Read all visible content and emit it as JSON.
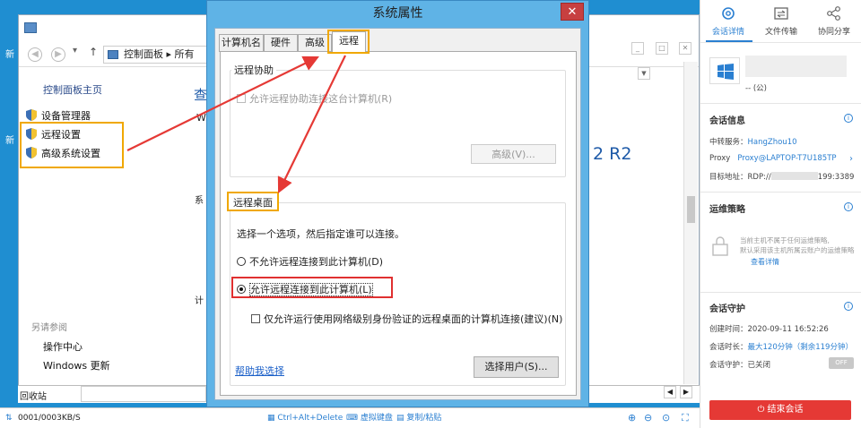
{
  "control_panel": {
    "window_icon_text": "",
    "side_label_1": "新",
    "side_label_2": "新",
    "breadcrumb": "控制面板 ▸ 所有",
    "home": "控制面板主页",
    "items": [
      "设备管理器",
      "远程设置",
      "高级系统设置"
    ],
    "see_also": "另请参阅",
    "links": [
      "操作中心",
      "Windows 更新"
    ],
    "partial_view": "查",
    "partial_w": "W",
    "partial_sys1": "系",
    "partial_sys2": "计",
    "r2": "2 R2",
    "recycle": "回收站"
  },
  "dialog": {
    "title": "系统属性",
    "close": "✕",
    "tabs": [
      "计算机名",
      "硬件",
      "高级",
      "远程"
    ],
    "remote_assist": {
      "title": "远程协助",
      "checkbox": "允许远程协助连接这台计算机(R)",
      "advanced": "高级(V)..."
    },
    "remote_desktop": {
      "title": "远程桌面",
      "prompt": "选择一个选项，然后指定谁可以连接。",
      "opt_deny": "不允许远程连接到此计算机(D)",
      "opt_allow": "允许远程连接到此计算机(L)",
      "nla": "仅允许运行使用网络级别身份验证的远程桌面的计算机连接(建议)(N)",
      "help": "帮助我选择",
      "select_users": "选择用户(S)..."
    }
  },
  "right_panel": {
    "tabs": [
      "会话详情",
      "文件传输",
      "协同分享"
    ],
    "host_sub": "-- (公)",
    "session_info": "会话信息",
    "relay_label": "中转服务：",
    "relay_value": "HangZhou10",
    "proxy_label": "Proxy",
    "proxy_value": "Proxy@LAPTOP-T7U185TP",
    "target_label": "目标地址：",
    "target_prefix": "RDP://",
    "target_suffix": "199:3389",
    "ops_policy": "运维策略",
    "policy_text_1": "当前主机不属于任何运维策略,",
    "policy_text_2": "默认采用该主机所属云账户的运维策略",
    "policy_link": "查看详情",
    "guard": "会话守护",
    "created_label": "创建时间：",
    "created_value": "2020-09-11 16:52:26",
    "duration_label": "会话时长：",
    "duration_value": "最大120分钟（剩余119分钟）",
    "guard_label": "会话守护：",
    "guard_value": "已关闭",
    "toggle": "OFF",
    "end_button": "结束会话"
  },
  "status_bar": {
    "traffic": "0001/0003KB/S",
    "ctrl_alt_del": "Ctrl+Alt+Delete",
    "virtual_kb": "虚拟键盘",
    "copy_paste": "复制/粘贴"
  },
  "colors": {
    "accent": "#2a7fd1",
    "highlight": "#f0a800",
    "danger": "#e53935"
  }
}
